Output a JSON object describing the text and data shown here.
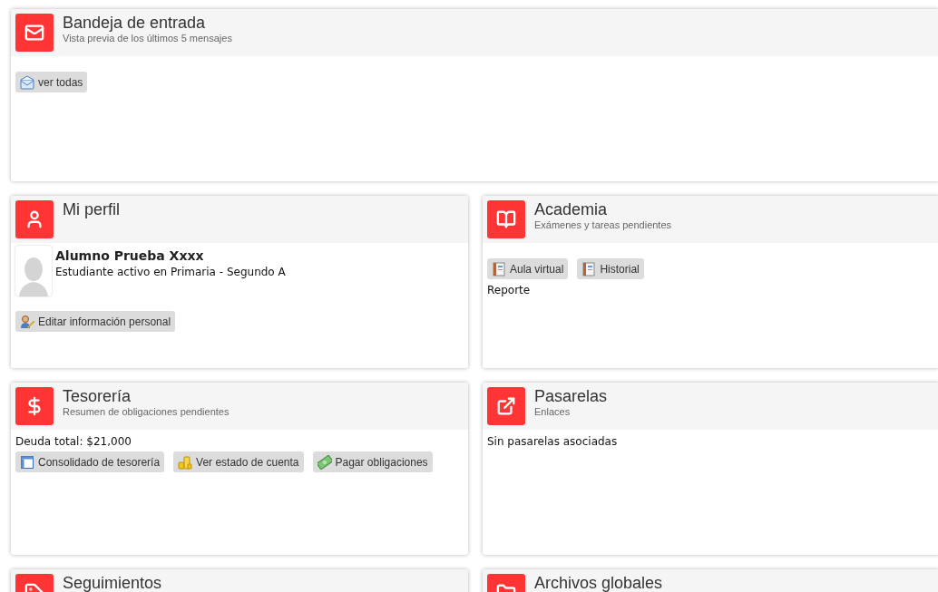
{
  "panels": [
    {
      "title": "Bandeja de entrada",
      "subtitle": "Vista previa de los últimos 5 mensajes",
      "body": [
        {
          "kind": "buttons",
          "buttons": [
            {
              "label": "ver todas"
            }
          ]
        }
      ]
    },
    {
      "title": "Mi perfil",
      "body": [
        {
          "kind": "profile",
          "name": "Alumno Prueba Xxxx",
          "description": "Estudiante activo en Primaria - Segundo A"
        },
        {
          "kind": "buttons",
          "buttons": [
            {
              "label": "Editar información personal"
            }
          ]
        }
      ]
    },
    {
      "title": "Academia",
      "subtitle": "Exámenes y tareas pendientes",
      "body": [
        {
          "kind": "buttons",
          "buttons": [
            {
              "label": "Aula virtual"
            },
            {
              "label": "Historial"
            }
          ]
        },
        {
          "kind": "text",
          "text": "Reporte"
        }
      ]
    },
    {
      "title": "Tesorería",
      "subtitle": "Resumen de obligaciones pendientes",
      "body": [
        {
          "kind": "text",
          "text": "Deuda total: $21,000"
        },
        {
          "kind": "buttons",
          "buttons": [
            {
              "label": "Consolidado de tesorería"
            },
            {
              "label": "Ver estado de cuenta"
            },
            {
              "label": "Pagar obligaciones"
            }
          ]
        }
      ]
    },
    {
      "title": "Pasarelas",
      "subtitle": "Enlaces",
      "body": [
        {
          "kind": "text",
          "text": "Sin pasarelas asociadas"
        }
      ]
    },
    {
      "title": "Seguimientos"
    },
    {
      "title": "Archivos globales"
    }
  ]
}
